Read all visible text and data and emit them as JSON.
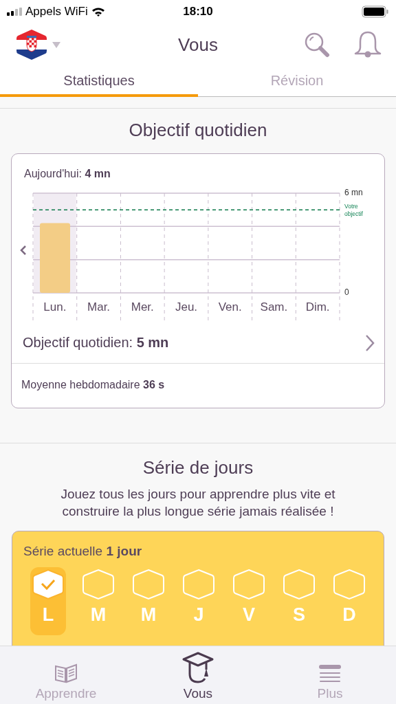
{
  "status_bar": {
    "carrier": "Appels WiFi",
    "time": "18:10"
  },
  "header": {
    "title": "Vous"
  },
  "tabs": [
    {
      "label": "Statistiques",
      "selected": true
    },
    {
      "label": "Révision",
      "selected": false
    }
  ],
  "daily_goal": {
    "title": "Objectif quotidien",
    "today": "Aujourd'hui: **4 mn**",
    "chart_data": {
      "type": "bar",
      "categories": [
        "Lun.",
        "Mar.",
        "Mer.",
        "Jeu.",
        "Ven.",
        "Sam.",
        "Dim."
      ],
      "values": [
        4.2,
        0,
        0,
        0,
        0,
        0,
        0
      ],
      "ylim": [
        0,
        6
      ],
      "yticks": [
        {
          "value": 0,
          "label": "0"
        },
        {
          "value": 6,
          "label": "6 mn"
        }
      ],
      "ref_lines": [
        {
          "axis": "y",
          "value": 5,
          "label": "Votre objectif"
        }
      ]
    },
    "day_columns": [
      {
        "selected": true
      },
      {
        "selected": false
      },
      {
        "selected": false
      },
      {
        "selected": false
      },
      {
        "selected": false
      },
      {
        "selected": false
      },
      {
        "selected": false
      }
    ],
    "goal_row": "Objectif quotidien: **5 mn**",
    "weekly_average": "Moyenne hebdomadaire **36 s**"
  },
  "streak": {
    "title": "Série de jours",
    "description": "Jouez tous les jours pour apprendre plus vite et construire la plus longue série jamais réalisée !",
    "current": "Série actuelle **1 jour**",
    "days": [
      {
        "letter": "L",
        "done": true
      },
      {
        "letter": "M",
        "done": false
      },
      {
        "letter": "M",
        "done": false
      },
      {
        "letter": "J",
        "done": false
      },
      {
        "letter": "V",
        "done": false
      },
      {
        "letter": "S",
        "done": false
      },
      {
        "letter": "D",
        "done": false
      }
    ]
  },
  "bottom_nav": [
    {
      "label": "Apprendre",
      "kind": "book",
      "selected": false
    },
    {
      "label": "Vous",
      "kind": "cap",
      "selected": true
    },
    {
      "label": "Plus",
      "kind": "lines",
      "selected": false
    }
  ]
}
